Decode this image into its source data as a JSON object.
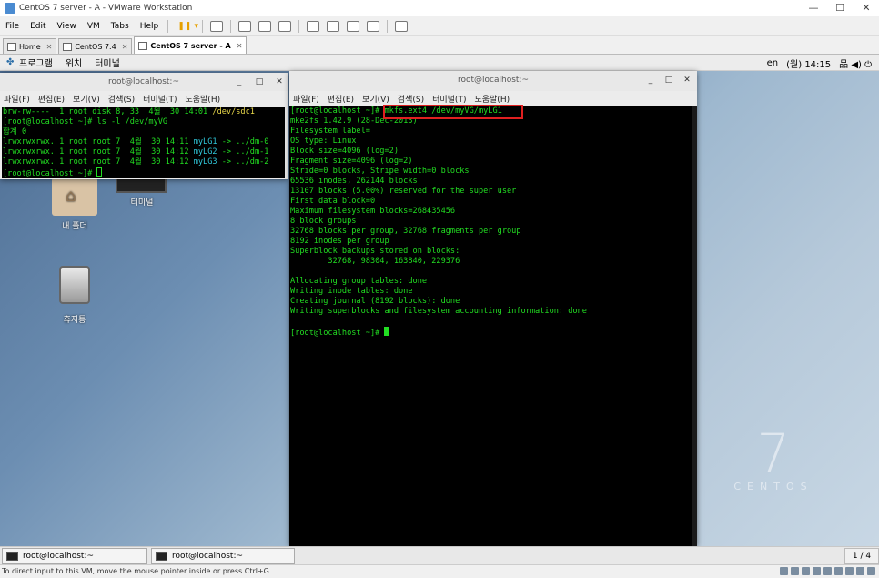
{
  "host": {
    "title": "CentOS 7 server - A - VMware Workstation",
    "window_controls": [
      "—",
      "☐",
      "✕"
    ],
    "menu": [
      "File",
      "Edit",
      "View",
      "VM",
      "Tabs",
      "Help"
    ],
    "pause_glyph": "❚❚ ▾",
    "tabs": [
      {
        "label": "Home",
        "active": false
      },
      {
        "label": "CentOS 7.4",
        "active": false
      },
      {
        "label": "CentOS 7 server - A",
        "active": true
      }
    ],
    "tab_close": "✕",
    "status_text": "To direct input to this VM, move the mouse pointer inside or press Ctrl+G."
  },
  "guest": {
    "top_menu": [
      "프로그램",
      "위치",
      "터미널"
    ],
    "top_right": {
      "lang": "en",
      "clock": "(월) 14:15",
      "icons": "品 ◀) ⏻"
    },
    "desktop_icons": {
      "folder": "내 폴더",
      "trash": "휴지통",
      "terminal": "터미널"
    },
    "centos_logo": {
      "numeral": "7",
      "word": "CENTOS"
    },
    "taskbar": {
      "items": [
        "root@localhost:~",
        "root@localhost:~"
      ],
      "pager": "1 / 4"
    }
  },
  "terminal_left": {
    "title": "root@localhost:~",
    "controls": [
      "_",
      "□",
      "✕"
    ],
    "menu": [
      "파일(F)",
      "편집(E)",
      "보기(V)",
      "검색(S)",
      "터미널(T)",
      "도움말(H)"
    ],
    "lines": [
      {
        "parts": [
          {
            "t": "brw-rw----  1 root disk 8, 33  4월  30 14:01 "
          },
          {
            "t": "/dev/sdc1",
            "c": "yellow"
          }
        ]
      },
      {
        "parts": [
          {
            "t": "[root@localhost ~]# ls -l /dev/myVG"
          }
        ]
      },
      {
        "parts": [
          {
            "t": "합계 0"
          }
        ]
      },
      {
        "parts": [
          {
            "t": "lrwxrwxrwx. 1 root root 7  4월  30 14:11 "
          },
          {
            "t": "myLG1",
            "c": "cyan"
          },
          {
            "t": " -> ../dm-0"
          }
        ]
      },
      {
        "parts": [
          {
            "t": "lrwxrwxrwx. 1 root root 7  4월  30 14:12 "
          },
          {
            "t": "myLG2",
            "c": "cyan"
          },
          {
            "t": " -> ../dm-1"
          }
        ]
      },
      {
        "parts": [
          {
            "t": "lrwxrwxrwx. 1 root root 7  4월  30 14:12 "
          },
          {
            "t": "myLG3",
            "c": "cyan"
          },
          {
            "t": " -> ../dm-2"
          }
        ]
      },
      {
        "parts": [
          {
            "t": "[root@localhost ~]# "
          }
        ],
        "cursor": "hollow"
      }
    ]
  },
  "terminal_right": {
    "title": "root@localhost:~",
    "controls": [
      "_",
      "□",
      "✕"
    ],
    "menu": [
      "파일(F)",
      "편집(E)",
      "보기(V)",
      "검색(S)",
      "터미널(T)",
      "도움말(H)"
    ],
    "lines": [
      "[root@localhost ~]# mkfs.ext4 /dev/myVG/myLG1",
      "mke2fs 1.42.9 (28-Dec-2013)",
      "Filesystem label=",
      "OS type: Linux",
      "Block size=4096 (log=2)",
      "Fragment size=4096 (log=2)",
      "Stride=0 blocks, Stripe width=0 blocks",
      "65536 inodes, 262144 blocks",
      "13107 blocks (5.00%) reserved for the super user",
      "First data block=0",
      "Maximum filesystem blocks=268435456",
      "8 block groups",
      "32768 blocks per group, 32768 fragments per group",
      "8192 inodes per group",
      "Superblock backups stored on blocks:",
      "        32768, 98304, 163840, 229376",
      "",
      "Allocating group tables: done",
      "Writing inode tables: done",
      "Creating journal (8192 blocks): done",
      "Writing superblocks and filesystem accounting information: done",
      "",
      "[root@localhost ~]# "
    ],
    "highlight_color": "#e02020"
  }
}
